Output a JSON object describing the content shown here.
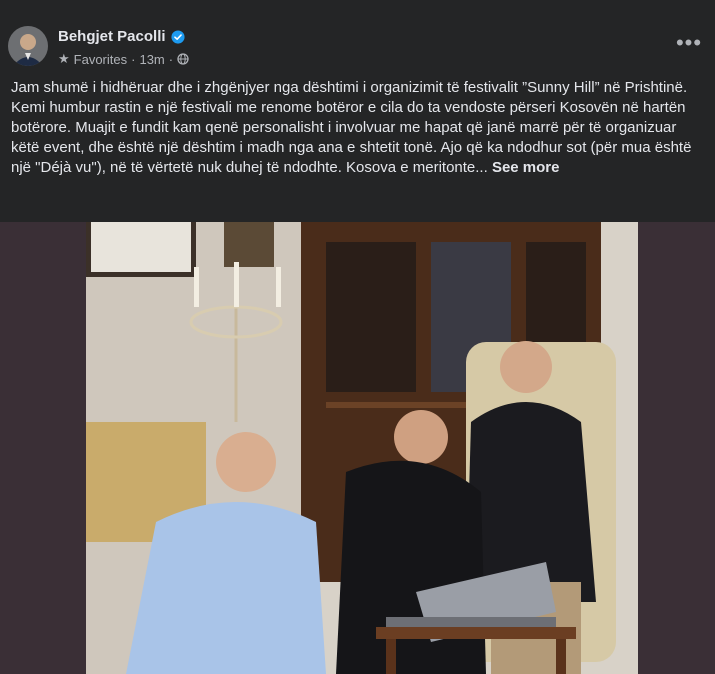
{
  "post": {
    "author": "Behgjet Pacolli",
    "meta_favorites": "Favorites",
    "meta_dot": "·",
    "meta_time": "13m",
    "meta_sep": "·",
    "body_text": "Jam shumë i hidhëruar dhe i zhgënjyer nga dështimi i organizimit të festivalit ”Sunny Hill” në Prishtinë. Kemi humbur rastin e një festivali me renome botëror e cila do ta vendoste përseri Kosovën në hartën botërore. Muajit e fundit kam qenë personalisht i involvuar me hapat që janë marrë për të organizuar këtë event, dhe është një dështim i madh nga ana e shtetit tonë. Ajo që ka ndodhur sot (për mua është një \"Déjà vu\"), në të vërtetë nuk duhej të ndodhte. Kosova e meritonte...",
    "see_more": "See more"
  },
  "colors": {
    "background": "#242526",
    "text": "#e4e6eb",
    "secondary": "#b0b3b8",
    "verified": "#1d9bf0",
    "photo_frame": "#3a2f36"
  },
  "icons": {
    "star": "star-icon",
    "globe": "globe-icon",
    "verified": "verified-badge-icon",
    "more": "more-options-icon"
  }
}
